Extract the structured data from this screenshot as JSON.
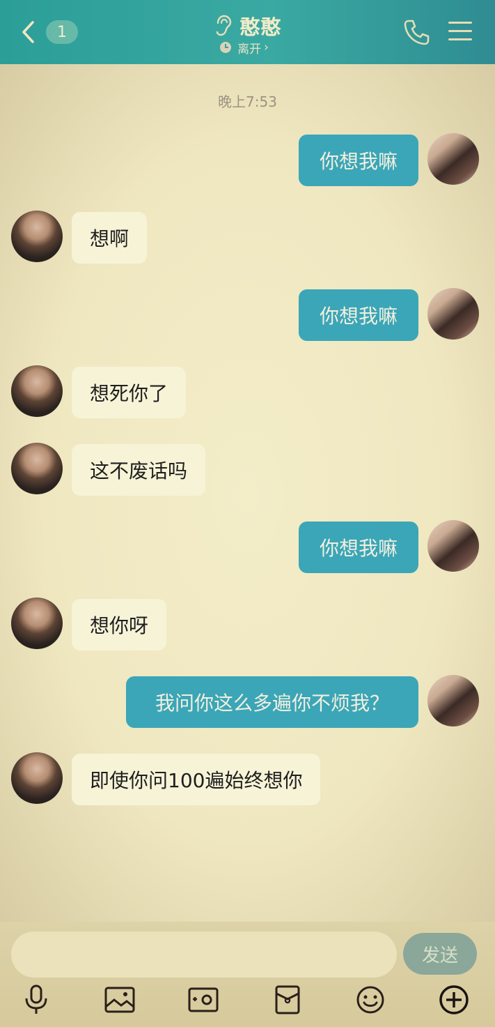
{
  "header": {
    "back_icon": "chevron-left-icon",
    "unread_count": "1",
    "contact_name": "憨憨",
    "status": "离开",
    "status_chevron": "›",
    "ear_icon": "ear-icon",
    "phone_icon": "phone-icon",
    "menu_icon": "menu-icon",
    "colors": {
      "bar": "#35a39d",
      "text": "#f4ecc9"
    }
  },
  "timestamp": "晚上7:53",
  "messages": [
    {
      "side": "right",
      "text": "你想我嘛"
    },
    {
      "side": "left",
      "text": "想啊"
    },
    {
      "side": "right",
      "text": "你想我嘛"
    },
    {
      "side": "left",
      "text": "想死你了"
    },
    {
      "side": "left",
      "text": "这不废话吗"
    },
    {
      "side": "right",
      "text": "你想我嘛"
    },
    {
      "side": "left",
      "text": "想你呀"
    },
    {
      "side": "right",
      "text": "我问你这么多遍你不烦我？"
    },
    {
      "side": "left",
      "text": "即使你问100遍始终想你"
    }
  ],
  "composer": {
    "input_value": "",
    "send_label": "发送",
    "tools": [
      "microphone-icon",
      "image-icon",
      "camera-icon",
      "red-packet-icon",
      "emoji-icon",
      "plus-icon"
    ]
  },
  "colors": {
    "background": "#efe8c4",
    "bubble_self": "#3ba6b7",
    "bubble_other": "#f7f3d7"
  }
}
